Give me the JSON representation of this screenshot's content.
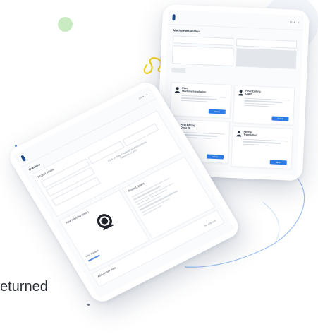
{
  "caption": {
    "text": "eturned"
  },
  "right_tablet": {
    "title": "Machine Installation",
    "cards": [
      {
        "title_line1": "Plan",
        "title_line2": "Machine Installation",
        "button": "Select"
      },
      {
        "title_line1": "Final Editing",
        "title_line2": "Light",
        "button": "Select"
      },
      {
        "title_line1": "Post Editing",
        "title_line2": "Cycle B",
        "button": "Select"
      },
      {
        "title_line1": "Further",
        "title_line2": "Translation",
        "button": "Select"
      }
    ]
  },
  "left_tablet": {
    "title": "Overview",
    "section_label": "Project details",
    "center_text_1": "Click or drag to upload your documents",
    "center_text_2": "Supported file types",
    "panel_left_label": "Your selected option",
    "panel_right_label": "Project details",
    "footer_label": "Add-on services",
    "footer_right": "No add-ons",
    "user_name": "User Account"
  },
  "colors": {
    "accent_blue": "#2f7be5",
    "logo_navy": "#1b4a8f",
    "orange_dot": "#ee5a24",
    "green_dot": "#c9ebc1",
    "yellow_scribble": "#f2d21b",
    "curve_blue": "#9ec2f2"
  },
  "icons": [
    "person-icon",
    "avatar-icon",
    "logo-icon"
  ]
}
